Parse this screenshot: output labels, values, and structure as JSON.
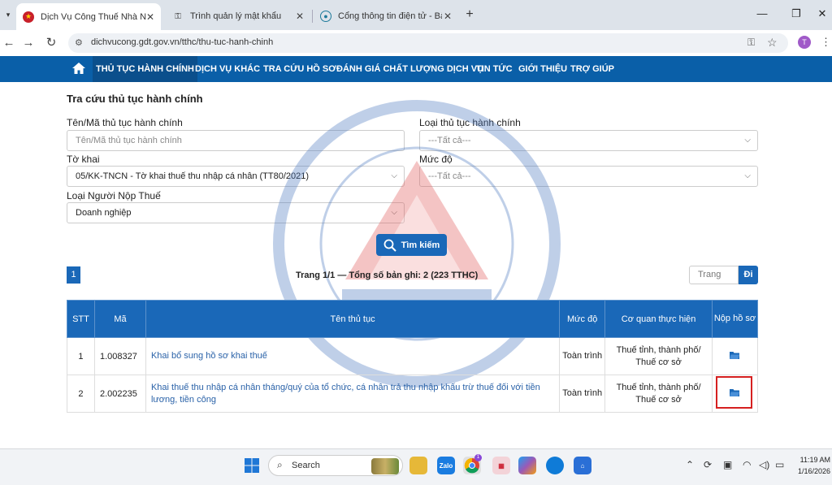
{
  "browser": {
    "tabs": [
      {
        "title": "Dịch Vụ Công Thuế Nhà Nước",
        "active": true
      },
      {
        "title": "Trình quản lý mật khẩu",
        "active": false
      },
      {
        "title": "Cổng thông tin điện tử - Bảo hi",
        "active": false
      }
    ],
    "url": "dichvucong.gdt.gov.vn/tthc/thu-tuc-hanh-chinh",
    "profile_initial": "T"
  },
  "nav": {
    "items": [
      "THỦ TỤC HÀNH CHÍNH",
      "DỊCH VỤ KHÁC",
      "TRA CỨU HỒ SƠ",
      "ĐÁNH GIÁ CHẤT LƯỢNG DỊCH VỤ",
      "TIN TỨC",
      "GIỚI THIỆU",
      "TRỢ GIÚP"
    ],
    "active_index": 0
  },
  "page": {
    "title": "Tra cứu thủ tục hành chính"
  },
  "form": {
    "name_label": "Tên/Mã thủ tục hành chính",
    "name_placeholder": "Tên/Mã thủ tục hành chính",
    "type_label": "Loại thủ tục hành chính",
    "type_value": "---Tất cả---",
    "declaration_label": "Tờ khai",
    "declaration_value": "05/KK-TNCN - Tờ khai thuế thu nhập cá nhân (TT80/2021)",
    "level_label": "Mức độ",
    "level_value": "---Tất cả---",
    "taxpayer_label": "Loại Người Nộp Thuế",
    "taxpayer_value": "Doanh nghiệp",
    "search_label": "Tìm kiếm"
  },
  "pagination": {
    "current_page": "1",
    "summary": "Trang 1/1 — Tổng số bản ghi: 2 (223 TTHC)",
    "goto_placeholder": "Trang",
    "goto_label": "Đi"
  },
  "table": {
    "headers": [
      "STT",
      "Mã",
      "Tên thủ tục",
      "Mức độ",
      "Cơ quan thực hiện",
      "Nộp hồ sơ"
    ],
    "rows": [
      {
        "stt": "1",
        "code": "1.008327",
        "name": "Khai bổ sung hồ sơ khai thuế",
        "level": "Toàn trình",
        "agency": "Thuế tỉnh, thành phố/ Thuế cơ sở"
      },
      {
        "stt": "2",
        "code": "2.002235",
        "name": "Khai thuế thu nhập cá nhân tháng/quý của tổ chức, cá nhân trả thu nhập khấu trừ thuế đối với tiền lương, tiền công",
        "level": "Toàn trình",
        "agency": "Thuế tỉnh, thành phố/ Thuế cơ sở"
      }
    ]
  },
  "taskbar": {
    "search_label": "Search",
    "time": "11:19 AM",
    "date": "1/16/2026",
    "badge": "1"
  },
  "colors": {
    "nav_blue": "#0a5fa8",
    "button_blue": "#1a68b8",
    "link_blue": "#2a62a8",
    "highlight_red": "#d62020"
  }
}
